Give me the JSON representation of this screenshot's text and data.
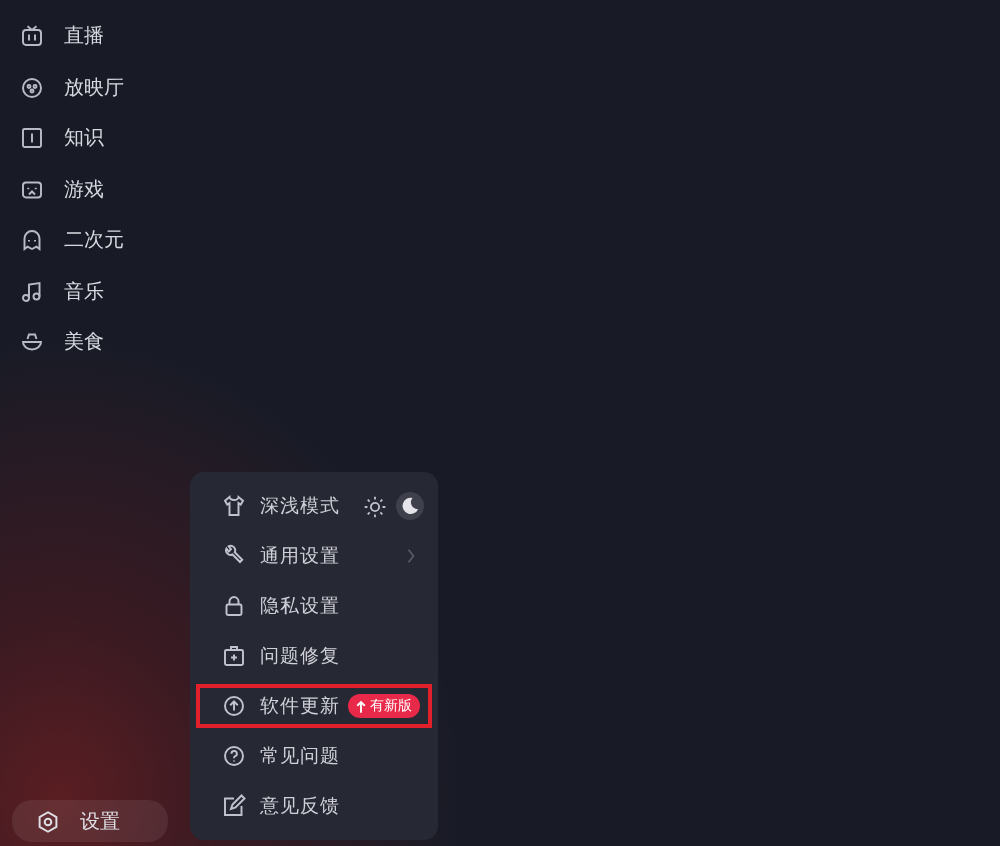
{
  "sidebar": {
    "items": [
      {
        "label": "直播"
      },
      {
        "label": "放映厅"
      },
      {
        "label": "知识"
      },
      {
        "label": "游戏"
      },
      {
        "label": "二次元"
      },
      {
        "label": "音乐"
      },
      {
        "label": "美食"
      }
    ]
  },
  "settings_button": {
    "label": "设置"
  },
  "menu": {
    "items": [
      {
        "kind": "theme",
        "label": "深浅模式",
        "theme_options": [
          {
            "selected": false
          },
          {
            "selected": true
          }
        ],
        "highlighted": false
      },
      {
        "kind": "submenu",
        "label": "通用设置",
        "highlighted": false
      },
      {
        "kind": "plain",
        "label": "隐私设置",
        "highlighted": false
      },
      {
        "kind": "plain",
        "label": "问题修复",
        "highlighted": false
      },
      {
        "kind": "plain",
        "label": "软件更新",
        "badge": "有新版",
        "highlighted": true
      },
      {
        "kind": "plain",
        "label": "常见问题",
        "highlighted": false
      },
      {
        "kind": "plain",
        "label": "意见反馈",
        "highlighted": false
      }
    ]
  }
}
